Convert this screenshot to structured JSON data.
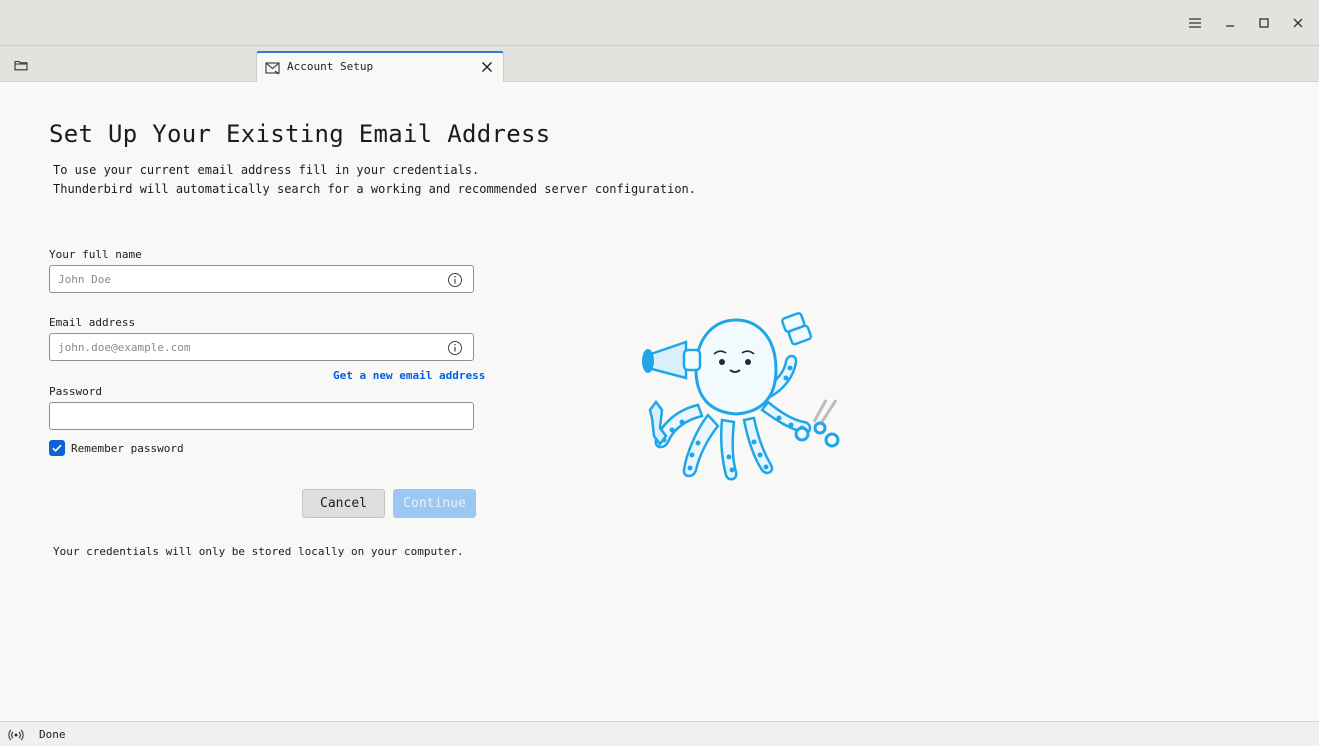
{
  "window": {
    "menu_icon": "hamburger-menu-icon",
    "minimize_icon": "minimize-icon",
    "maximize_icon": "maximize-icon",
    "close_icon": "close-icon"
  },
  "tabs": {
    "folder_icon": "folder-icon",
    "active_tab": {
      "icon": "envelope-icon",
      "label": "Account Setup"
    }
  },
  "main": {
    "heading": "Set Up Your Existing Email Address",
    "description_line1": "To use your current email address fill in your credentials.",
    "description_line2": "Thunderbird will automatically search for a working and recommended server configuration.",
    "full_name": {
      "label": "Your full name",
      "placeholder": "John Doe",
      "value": ""
    },
    "email": {
      "label": "Email address",
      "placeholder": "john.doe@example.com",
      "value": ""
    },
    "get_new_email_link": "Get a new email address",
    "password": {
      "label": "Password",
      "value": ""
    },
    "remember_password": {
      "label": "Remember password",
      "checked": true
    },
    "cancel_label": "Cancel",
    "continue_label": "Continue",
    "footnote": "Your credentials will only be stored locally on your computer."
  },
  "statusbar": {
    "icon": "online-status-icon",
    "text": "Done"
  },
  "colors": {
    "accent": "#0a64d6",
    "link": "#0060df",
    "continue_disabled": "#9cc7f2",
    "tab_highlight": "#2f7bd4",
    "mascot_blue": "#1fa6e8"
  }
}
